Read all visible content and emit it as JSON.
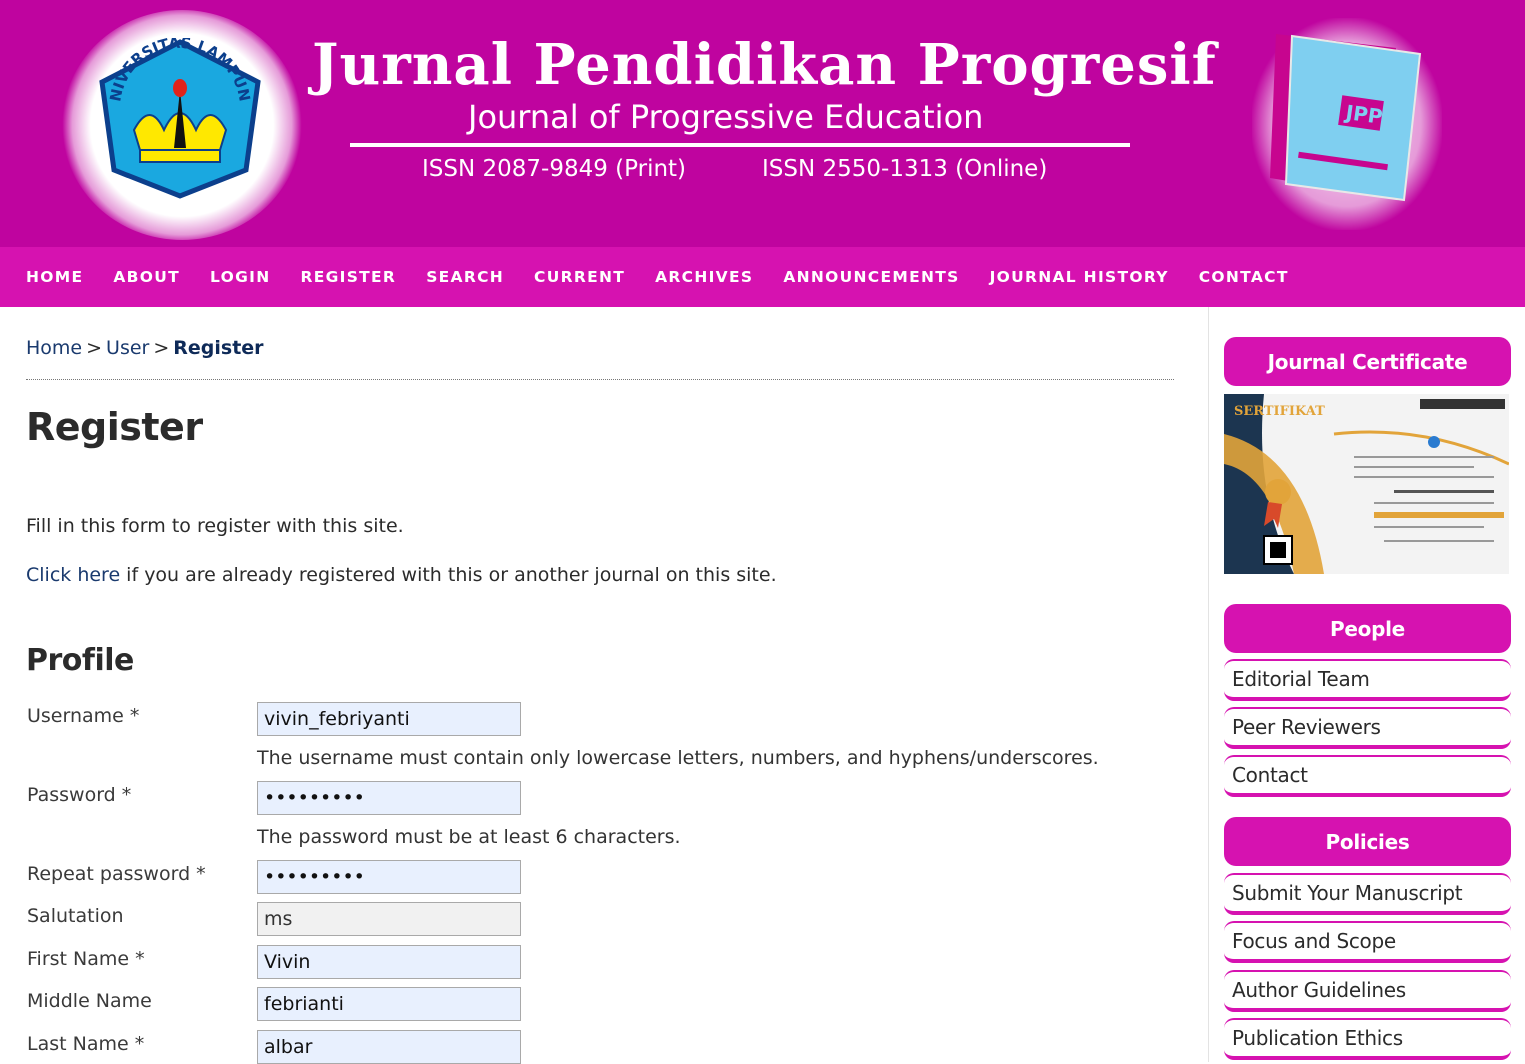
{
  "header": {
    "logo_text": "UNIVERSITAS LAMPUNG",
    "title": "Jurnal Pendidikan Progresif",
    "subtitle": "Journal of Progressive Education",
    "issn_print": "ISSN 2087-9849 (Print)",
    "issn_online": "ISSN 2550-1313 (Online)",
    "cover_label": "JPP",
    "colors": {
      "banner": "#bf049f",
      "nav": "#d612b0"
    }
  },
  "nav": {
    "items": [
      "HOME",
      "ABOUT",
      "LOGIN",
      "REGISTER",
      "SEARCH",
      "CURRENT",
      "ARCHIVES",
      "ANNOUNCEMENTS",
      "JOURNAL HISTORY",
      "CONTACT"
    ]
  },
  "breadcrumb": {
    "home": "Home",
    "sep": ">",
    "user": "User",
    "current": "Register"
  },
  "page": {
    "title": "Register",
    "intro": "Fill in this form to register with this site.",
    "already_link": "Click here",
    "already_rest": " if you are already registered with this or another journal on this site."
  },
  "profile": {
    "title": "Profile",
    "username": {
      "label": "Username *",
      "value": "vivin_febriyanti",
      "hint": "The username must contain only lowercase letters, numbers, and hyphens/underscores."
    },
    "password": {
      "label": "Password *",
      "value": "•••••••••",
      "hint": "The password must be at least 6 characters."
    },
    "repeat_password": {
      "label": "Repeat password *",
      "value": "•••••••••"
    },
    "salutation": {
      "label": "Salutation",
      "value": "ms"
    },
    "first_name": {
      "label": "First Name *",
      "value": "Vivin"
    },
    "middle_name": {
      "label": "Middle Name",
      "value": "febrianti"
    },
    "last_name": {
      "label": "Last Name *",
      "value": "albar"
    }
  },
  "sidebar": {
    "certificate_title": "Journal Certificate",
    "certificate_heading": "SERTIFIKAT",
    "people_title": "People",
    "people_links": [
      "Editorial Team",
      "Peer Reviewers",
      "Contact"
    ],
    "policies_title": "Policies",
    "policies_links": [
      "Submit Your Manuscript",
      "Focus and Scope",
      "Author Guidelines",
      "Publication Ethics"
    ]
  }
}
